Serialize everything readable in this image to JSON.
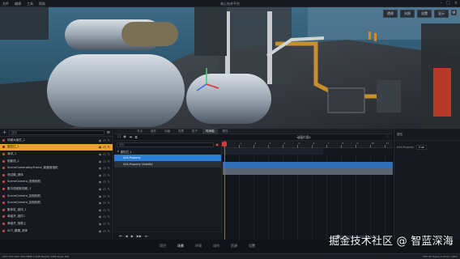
{
  "topbar": {
    "menu": [
      "文件",
      "编辑",
      "工具",
      "帮助"
    ],
    "title": "海上钻井平台",
    "window_buttons": [
      "–",
      "□",
      "×"
    ]
  },
  "viewport": {
    "toolbar": [
      "透视",
      "光照",
      "设置",
      "显示"
    ]
  },
  "hierarchy": {
    "search_placeholder": "搜索",
    "items": [
      {
        "label": "场景大纲栏_1",
        "selected": false
      },
      {
        "label": "属性栏_1",
        "selected": true
      },
      {
        "label": "海洋_1",
        "selected": false
      },
      {
        "label": "阴影质_1",
        "selected": false
      },
      {
        "label": "SceneCameraKeyFrame_新建帧相机",
        "selected": false
      },
      {
        "label": "测试模_测体",
        "selected": false
      },
      {
        "label": "SceneCamera_视角相机",
        "selected": false
      },
      {
        "label": "集中视频影视频_1",
        "selected": false
      },
      {
        "label": "SceneCamera_回线相机",
        "selected": false
      },
      {
        "label": "SceneCamera_回线相机",
        "selected": false
      },
      {
        "label": "集体发_组体_1",
        "selected": false
      },
      {
        "label": "单组开_组件1",
        "selected": false
      },
      {
        "label": "单组开_测原上",
        "selected": false
      },
      {
        "label": "ACT_模模_测体",
        "selected": false
      }
    ]
  },
  "timeline": {
    "tabs": [
      "节点",
      "组件",
      "动画",
      "材质",
      "粒子",
      "时间轴",
      "属性"
    ],
    "active_tab": "时间轴",
    "title": "动画片段1",
    "search_placeholder": "搜索",
    "group_label": "属性栏_1",
    "tracks": [
      "XXX-Property",
      "XXX-Property Visibility"
    ],
    "ruler_labels": [
      "0",
      "1",
      "2",
      "3",
      "4",
      "5",
      "6",
      "7",
      "8",
      "9",
      "10",
      "11"
    ],
    "playhead_frame": 0,
    "playback_controls": [
      "⏮",
      "◀",
      "▶",
      "▶▶",
      "⏭"
    ]
  },
  "inspector": {
    "header": "属性",
    "property_key": "XXX-Property",
    "property_value": "true"
  },
  "dock": {
    "items": [
      "项目",
      "场景",
      "环境",
      "动作",
      "资源",
      "设置"
    ],
    "active": "场景"
  },
  "watermark": "掘金技术社区 @ 智蓝深海",
  "status": {
    "left": "CPU: 12%   GPU: 36%   MEM: 2.1GB   Objects: 1086   Draw: 218",
    "right": "FPS: 60   Frame: 0   Zoom: 100%"
  },
  "colors": {
    "accent_selected": "#e8a226",
    "track_active": "#2b7fd6",
    "playhead": "#e04646"
  }
}
